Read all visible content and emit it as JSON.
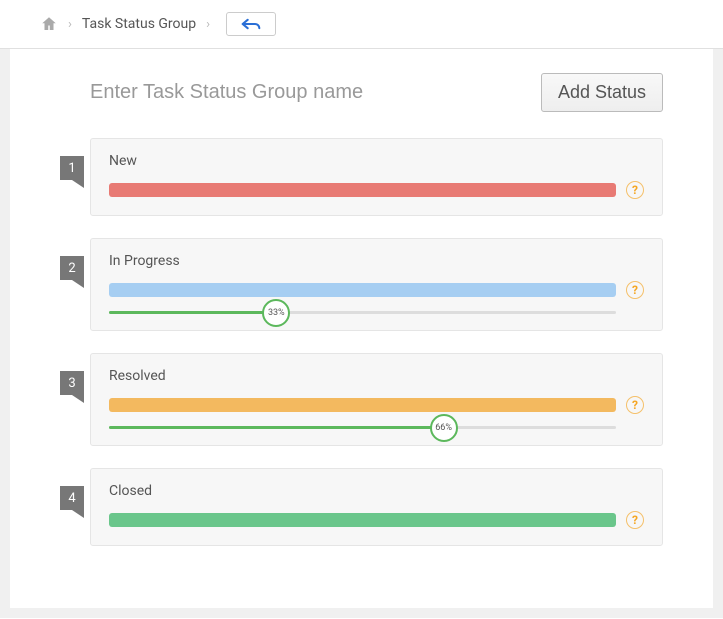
{
  "breadcrumb": {
    "label": "Task Status Group"
  },
  "header": {
    "name_placeholder": "Enter Task Status Group name",
    "name_value": "",
    "add_status_label": "Add Status"
  },
  "statuses": [
    {
      "step": "1",
      "name": "New",
      "color": "#e87a74",
      "has_slider": false,
      "pct": 0,
      "pct_label": ""
    },
    {
      "step": "2",
      "name": "In Progress",
      "color": "#a6cef2",
      "has_slider": true,
      "pct": 33,
      "pct_label": "33%"
    },
    {
      "step": "3",
      "name": "Resolved",
      "color": "#f3b95f",
      "has_slider": true,
      "pct": 66,
      "pct_label": "66%"
    },
    {
      "step": "4",
      "name": "Closed",
      "color": "#6ac68b",
      "has_slider": false,
      "pct": 100,
      "pct_label": ""
    }
  ],
  "help_glyph": "?"
}
